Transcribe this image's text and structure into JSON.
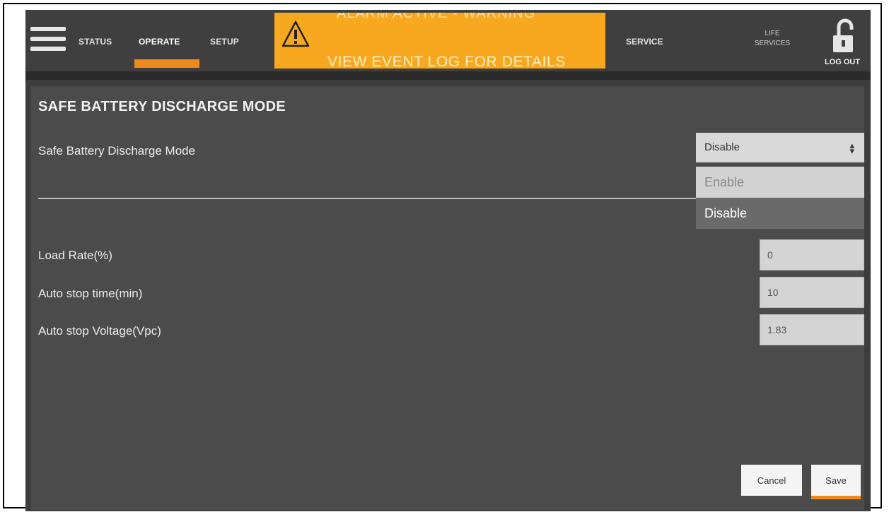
{
  "nav": {
    "status": "STATUS",
    "operate": "OPERATE",
    "setup": "SETUP",
    "service": "SERVICE",
    "life_services_line1": "LIFE",
    "life_services_line2": "SERVICES",
    "logout": "LOG OUT",
    "active_tab": "OPERATE"
  },
  "alert": {
    "top_text": "ALARM ACTIVE - WARNING",
    "bottom_text": "VIEW EVENT LOG FOR DETAILS",
    "icon": "warning-triangle-icon",
    "color": "#f7a81e"
  },
  "page": {
    "title": "SAFE BATTERY DISCHARGE MODE"
  },
  "mode": {
    "label": "Safe Battery Discharge Mode",
    "selected": "Disable",
    "options": [
      "Enable",
      "Disable"
    ]
  },
  "fields": {
    "load_rate_label": "Load Rate(%)",
    "load_rate_value": "0",
    "auto_stop_time_label": "Auto stop time(min)",
    "auto_stop_time_value": "10",
    "auto_stop_voltage_label": "Auto stop Voltage(Vpc)",
    "auto_stop_voltage_value": "1.83"
  },
  "buttons": {
    "cancel": "Cancel",
    "save": "Save"
  },
  "colors": {
    "accent": "#f08a1c",
    "background": "#4b4b4b",
    "topbar": "#3f3f3f"
  }
}
